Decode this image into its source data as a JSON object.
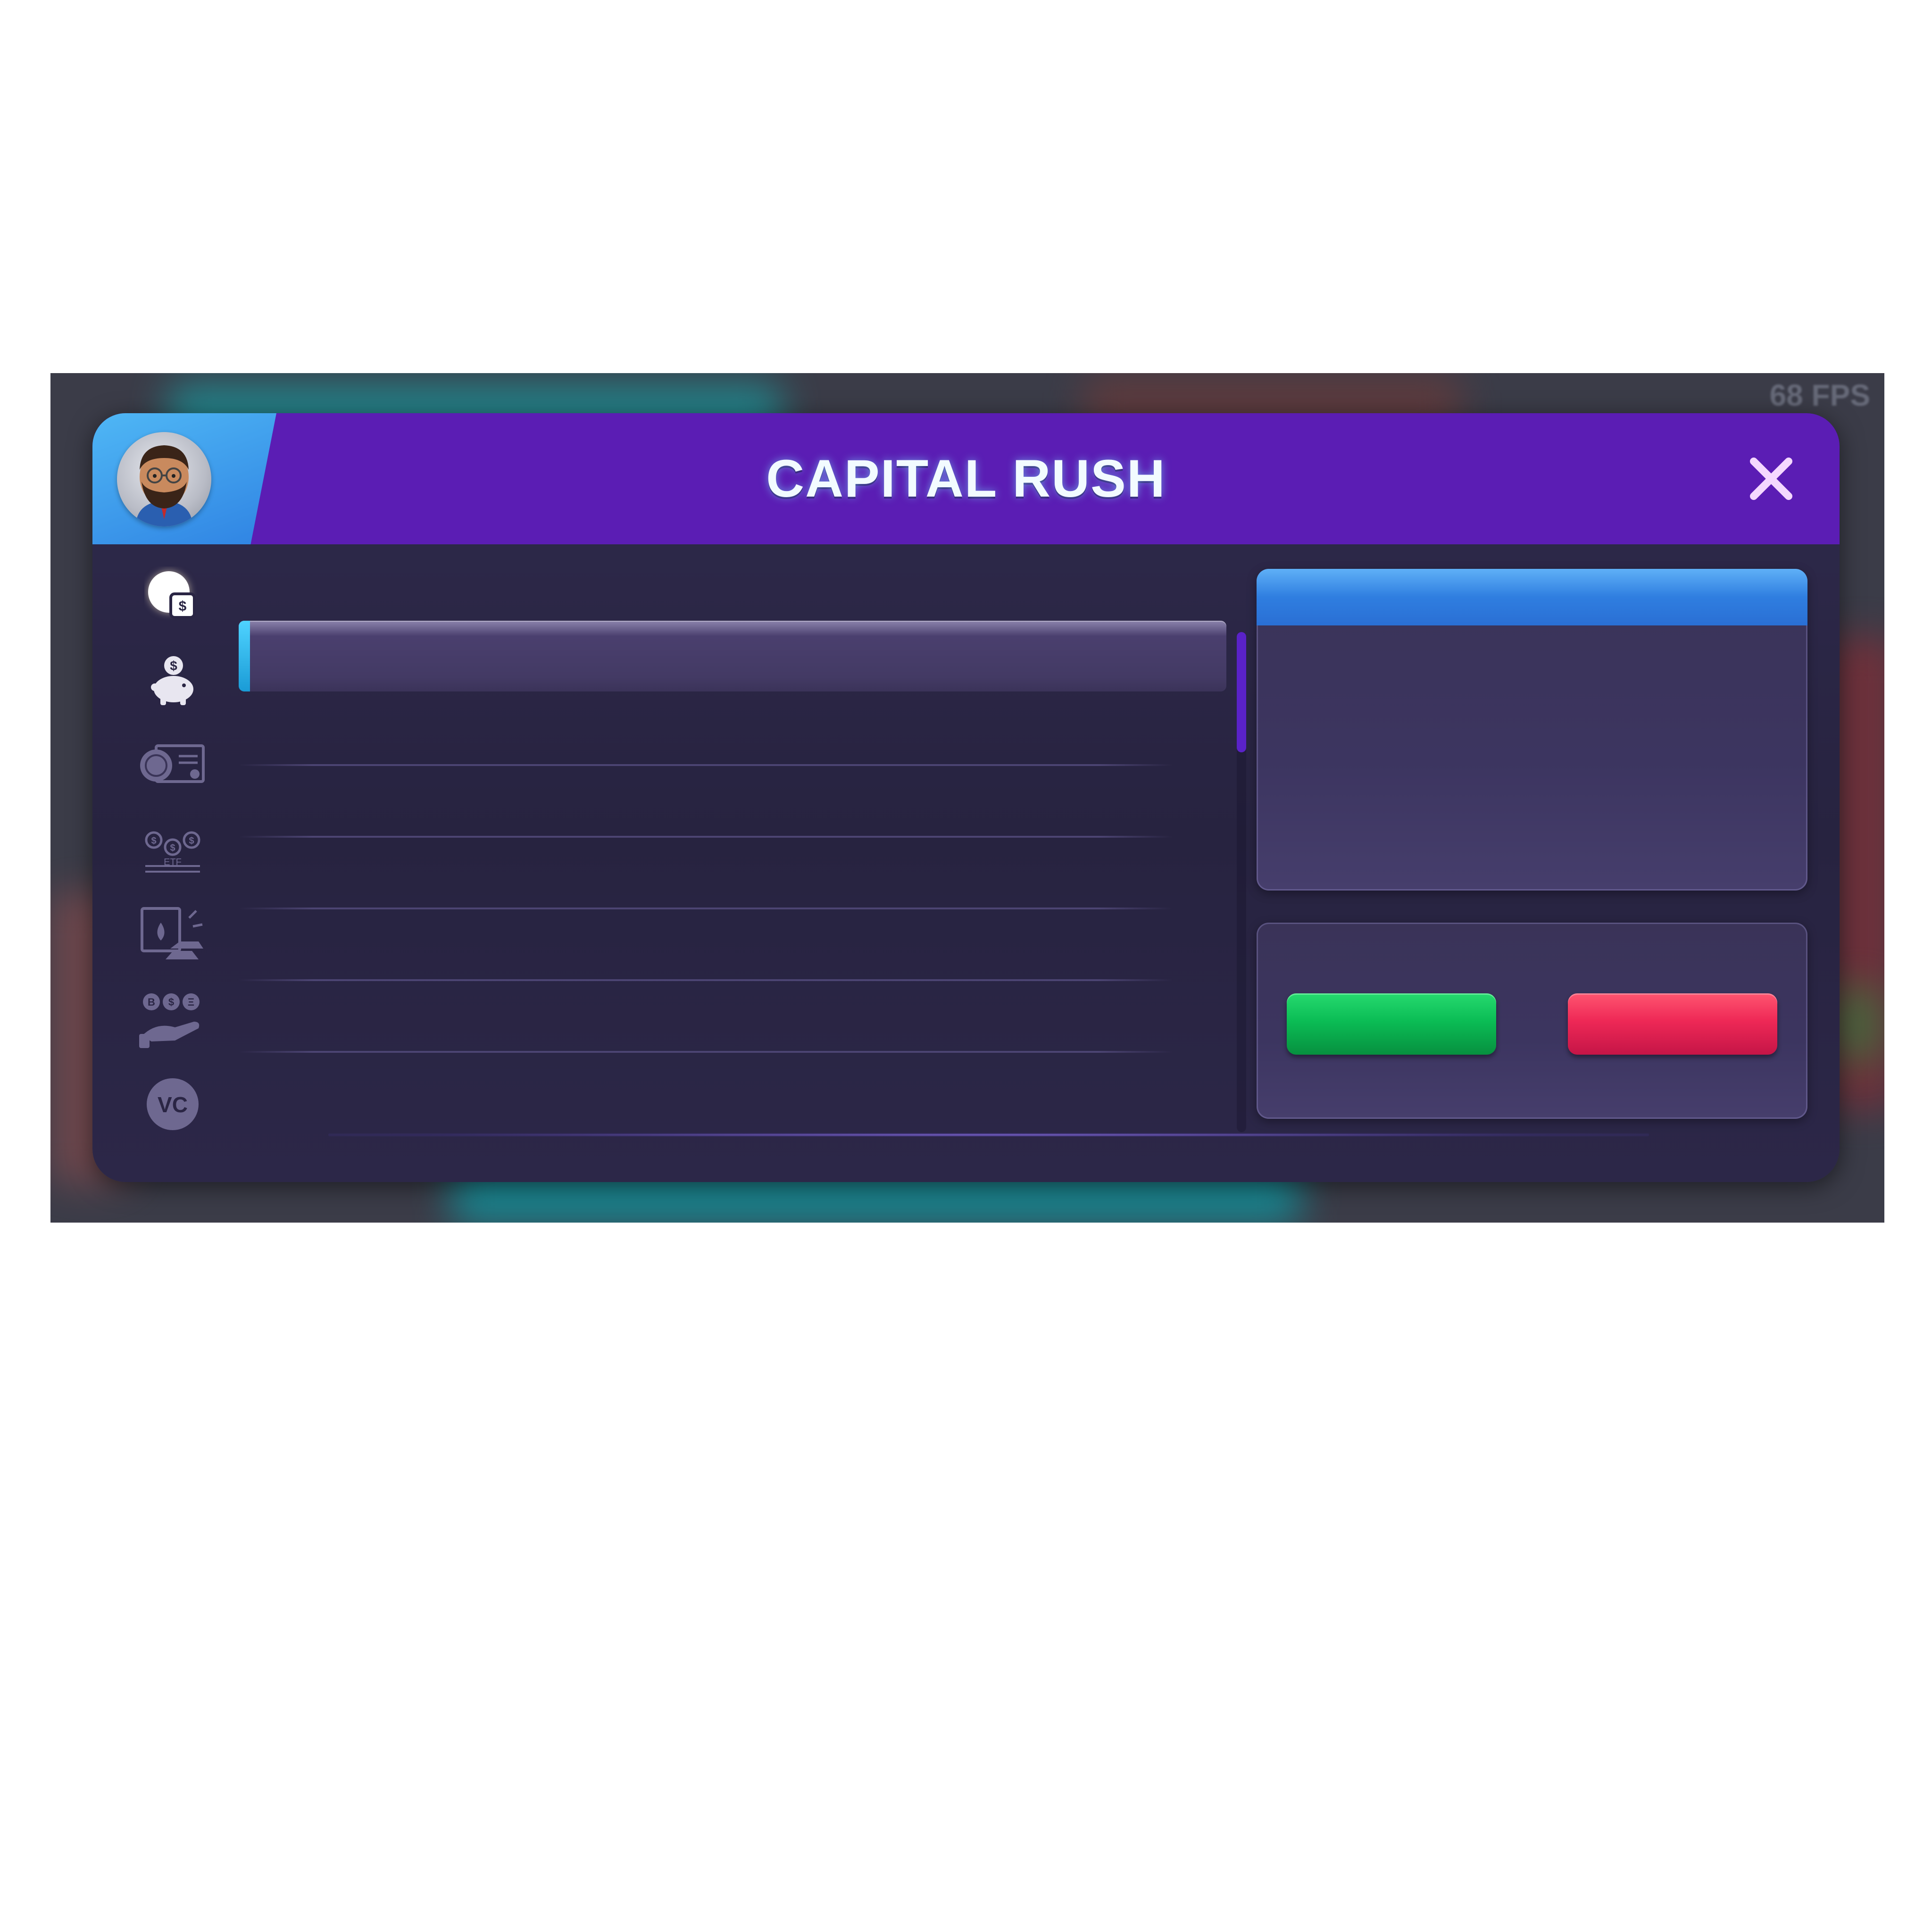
{
  "hud": {
    "fps_text": "68 FPS"
  },
  "header": {
    "title": "CAPITAL RUSH",
    "avatar": "player-avatar",
    "close_icon": "close-icon"
  },
  "sidebar": {
    "items": [
      {
        "icon": "stocks-pie-icon",
        "active": true
      },
      {
        "icon": "piggy-bank-icon",
        "active": false
      },
      {
        "icon": "bonds-certificate-icon",
        "active": false
      },
      {
        "icon": "etf-icon",
        "active": false,
        "label": "ETF"
      },
      {
        "icon": "commodities-icon",
        "active": false
      },
      {
        "icon": "crypto-hand-icon",
        "active": false
      },
      {
        "icon": "venture-capital-icon",
        "active": false,
        "label": "VC"
      }
    ]
  },
  "colors": {
    "header": "#5b1db4",
    "avatar_tab": "#3a96ea",
    "panel": "#2a2544",
    "accent_blue": "#2f7ee0",
    "buy_green": "#0bbd55",
    "sell_red": "#ee2856",
    "scroll_thumb": "#5a22c8"
  }
}
